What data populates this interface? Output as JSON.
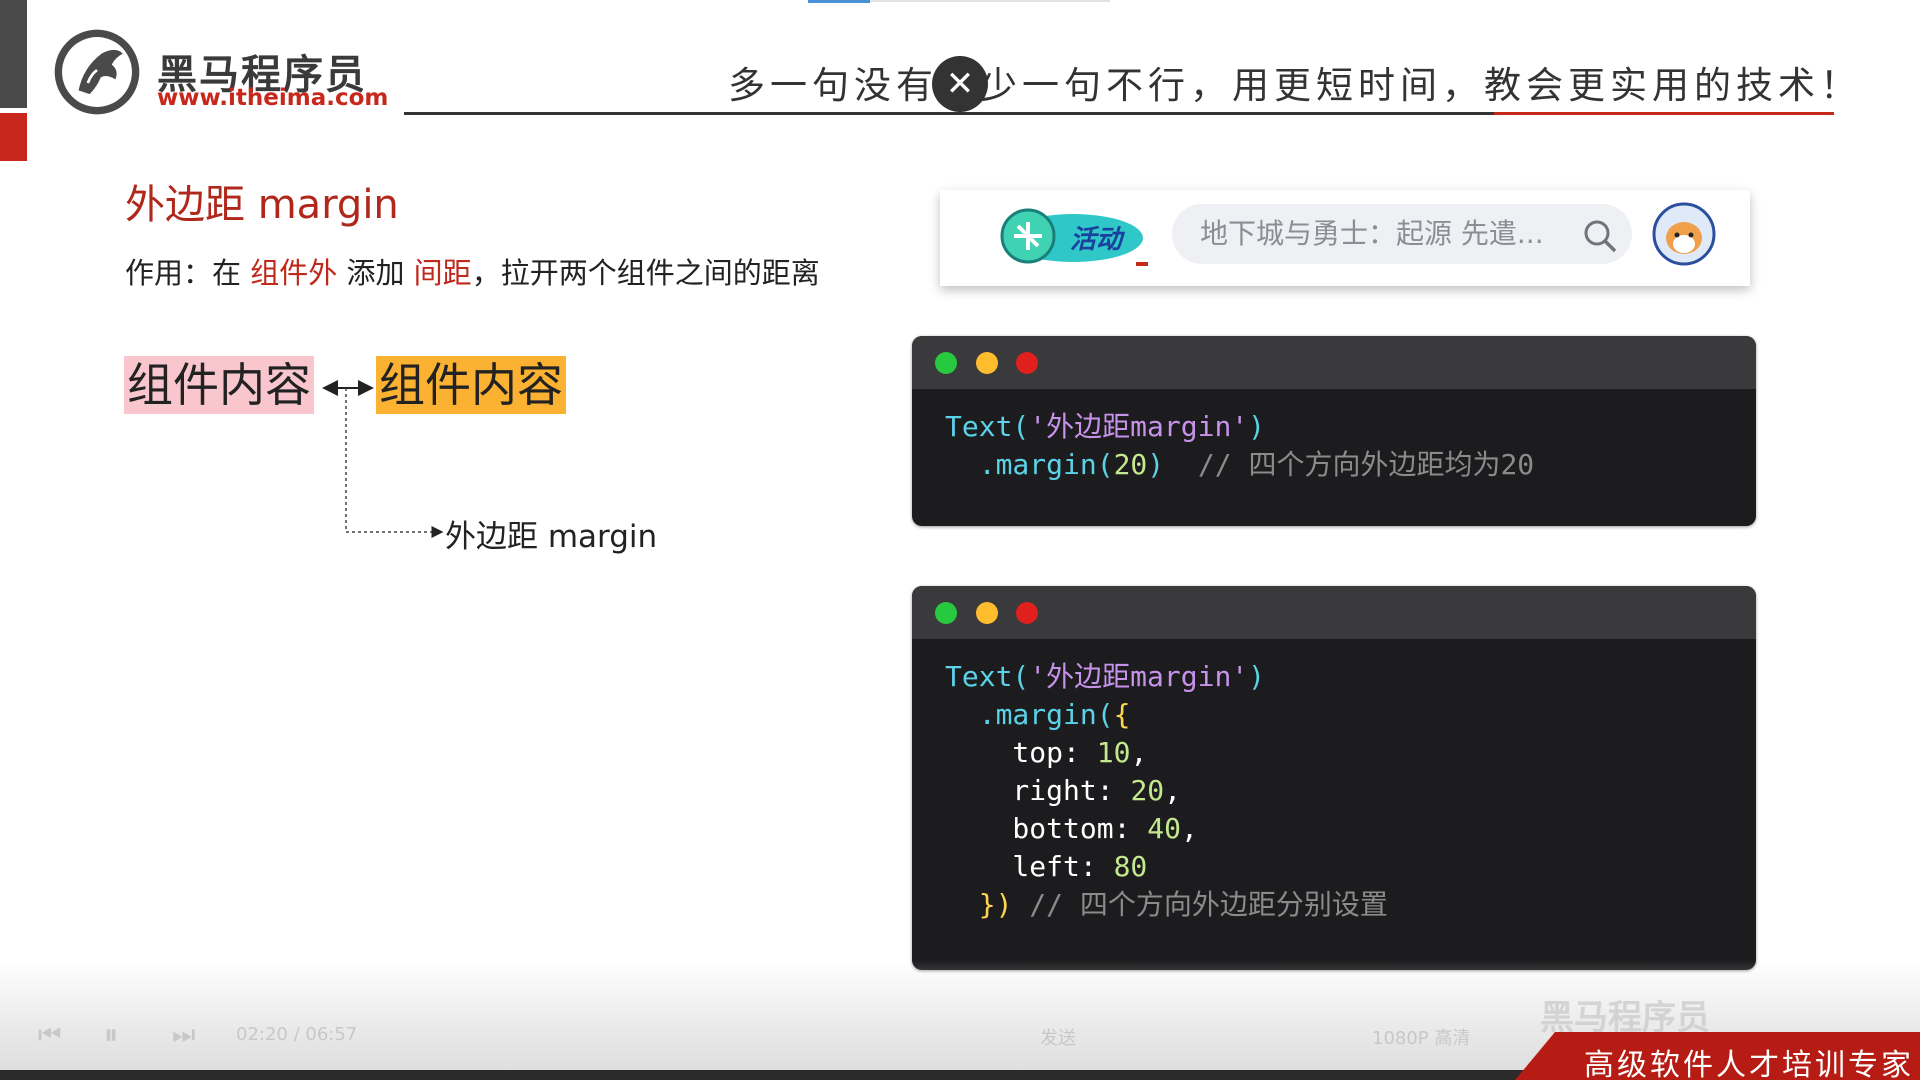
{
  "header": {
    "logo_name": "黑马程序员",
    "logo_url": "www.itheima.com",
    "slogan": "多一句没有，少一句不行，用更短时间，教会更实用的技术！"
  },
  "close_button": {
    "glyph": "✕"
  },
  "slide": {
    "title": "外边距 margin",
    "desc": {
      "prefix": "作用：在 ",
      "hl1": "组件外",
      "mid": " 添加 ",
      "hl2": "间距",
      "suffix": "，拉开两个组件之间的距离"
    },
    "box1": "组件内容",
    "box2": "组件内容",
    "margin_label": "外边距 margin"
  },
  "search_strip": {
    "activity_label": "活动",
    "placeholder": "地下城与勇士：起源 先遣..."
  },
  "code1": {
    "l1_fn": "Text(",
    "l1_str": "'外边距margin'",
    "l1_end": ")",
    "l2_fn": "  .margin(",
    "l2_num": "20",
    "l2_end": ")  ",
    "l2_com": "// 四个方向外边距均为20"
  },
  "code2": {
    "l1_fn": "Text(",
    "l1_str": "'外边距margin'",
    "l1_end": ")",
    "l2_fn": "  .margin(",
    "l2_br": "{",
    "top_key": "    top: ",
    "top_val": "10",
    "right_key": "    right: ",
    "right_val": "20",
    "bottom_key": "    bottom: ",
    "bottom_val": "40",
    "left_key": "    left: ",
    "left_val": "80",
    "l7_br": "  })",
    "l7_com": " // 四个方向外边距分别设置"
  },
  "player": {
    "time": "02:20 / 06:57",
    "send": "发送",
    "quality": "1080P 高清",
    "watermark": "黑马程序员",
    "banner": "高级软件人才培训专家"
  },
  "colors": {
    "brand_red": "#c8281c",
    "pink_box": "#f9c6ce",
    "orange_box": "#fbb232"
  }
}
